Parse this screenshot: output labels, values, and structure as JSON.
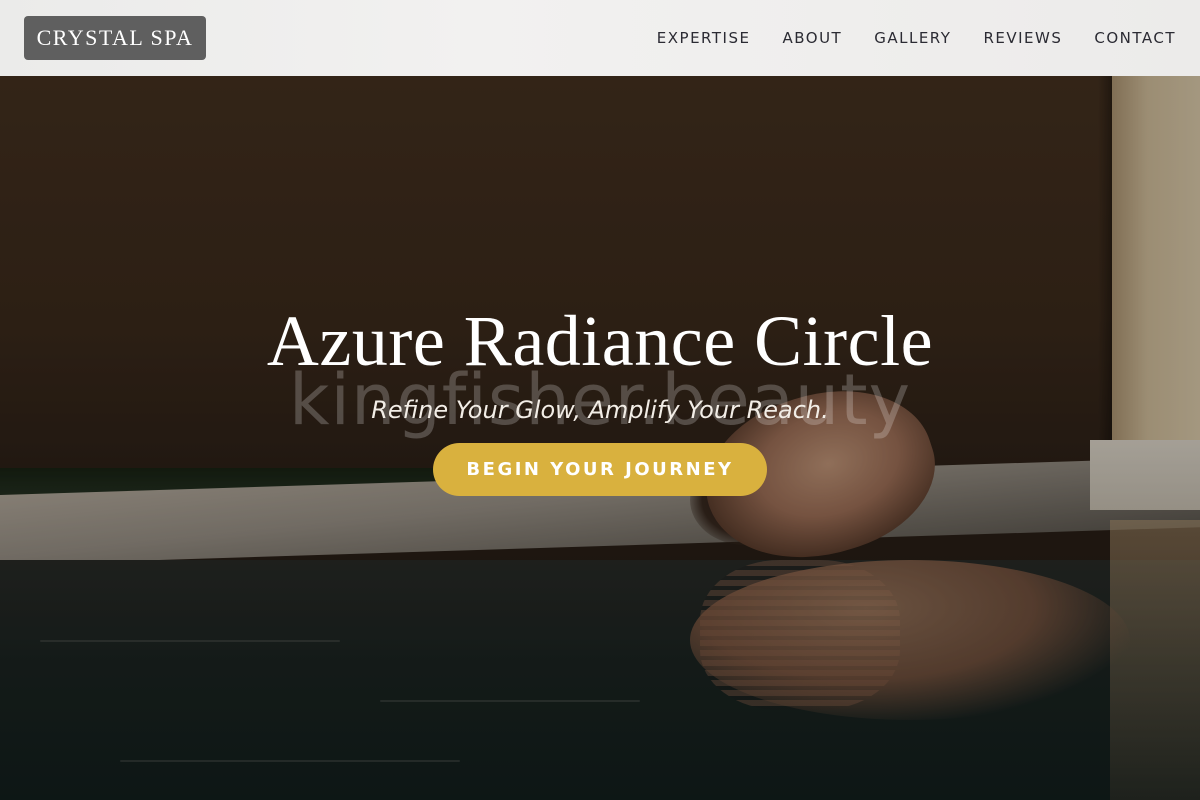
{
  "header": {
    "logo": "CRYSTAL SPA",
    "nav": [
      {
        "label": "EXPERTISE"
      },
      {
        "label": "ABOUT"
      },
      {
        "label": "GALLERY"
      },
      {
        "label": "REVIEWS"
      },
      {
        "label": "CONTACT"
      }
    ]
  },
  "hero": {
    "watermark": "kingfisher.beauty",
    "title": "Azure Radiance Circle",
    "subtitle": "Refine Your Glow, Amplify Your Reach.",
    "cta_label": "BEGIN YOUR JOURNEY"
  },
  "colors": {
    "accent": "#d9b13e",
    "header_bg": "#efeeed",
    "logo_bg": "#5f5f5f",
    "nav_text": "#2b2b33"
  }
}
